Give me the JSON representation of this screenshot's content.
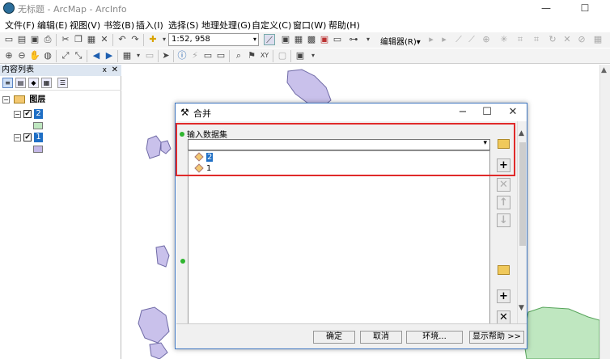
{
  "window": {
    "title": "无标题 - ArcMap - ArcInfo",
    "minimize": "—",
    "maximize": "☐"
  },
  "menu": [
    "文件(F)",
    "编辑(E)",
    "视图(V)",
    "书签(B)",
    "插入(I)",
    "选择(S)",
    "地理处理(G)",
    "自定义(C)",
    "窗口(W)",
    "帮助(H)"
  ],
  "toolbar": {
    "scale": "1:52, 958",
    "editor_label": "编辑器(R)▾"
  },
  "toc": {
    "title": "内容列表",
    "pin": "ⅹ",
    "close": "✕",
    "root_label": "图层",
    "layers": [
      {
        "label": "2",
        "checked": "✔",
        "color": "#bfe7c0"
      },
      {
        "label": "1",
        "checked": "✔",
        "color": "#c3b7e6"
      }
    ]
  },
  "dialog": {
    "title": "合并",
    "input_label": "输入数据集",
    "items": [
      "2",
      "1"
    ],
    "buttons": {
      "ok": "确定",
      "cancel": "取消",
      "env": "环境...",
      "help": "显示帮助 >>"
    }
  },
  "colors": {
    "polygon_fill": "#c9c1eb",
    "polygon_stroke": "#6f6aa6",
    "green_fill": "#bfe7c0",
    "highlight": "#e02a2a",
    "selection": "#1f6fc5"
  }
}
